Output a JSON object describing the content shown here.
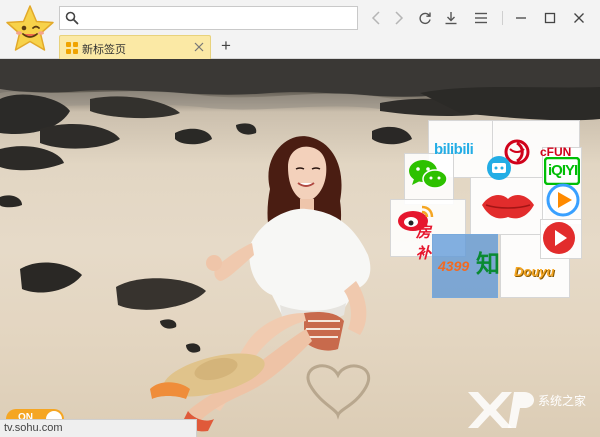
{
  "browser": {
    "address_value": "",
    "tab": {
      "title": "新标签页"
    },
    "new_tab_label": "+",
    "status_url": "tv.sohu.com"
  },
  "apps": [
    {
      "name": "bilibili",
      "label": "bilibili",
      "color": "#23ade5"
    },
    {
      "name": "iqiyi",
      "label": "iQIYI",
      "color": "#00be06"
    },
    {
      "name": "acfun",
      "label": "cFUN",
      "color": "#d0021b"
    },
    {
      "name": "wechat",
      "label": "",
      "color": "#2dc100"
    },
    {
      "name": "weibo",
      "label": "",
      "color": "#e6162d"
    },
    {
      "name": "fanli",
      "label": "房补",
      "color": "#e6162d"
    },
    {
      "name": "kissing-lips",
      "label": "",
      "color": "#e22c2c"
    },
    {
      "name": "game-4399",
      "label": "4399",
      "color": "#f26a21"
    },
    {
      "name": "zhihu",
      "label": "知",
      "color": "#0084ff"
    },
    {
      "name": "douyu",
      "label": "Douyu",
      "color": "#f5a623"
    },
    {
      "name": "tencent-video",
      "label": "",
      "color": "#ff5b00"
    }
  ],
  "toggle": {
    "label": "ON"
  },
  "watermark": {
    "text": "系统之家"
  }
}
